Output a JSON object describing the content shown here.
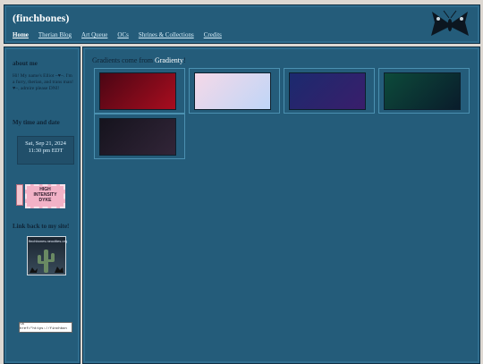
{
  "header": {
    "title": "(finchbones)",
    "nav": [
      "Home",
      "Therian Blog",
      "Art Queue",
      "OCs",
      "Shrines & Collections",
      "Credits"
    ],
    "logo_icon": "moth-icon"
  },
  "sidebar": {
    "about_heading": "about me",
    "about_text": "Hi! My name's Elliot ~♥~. I'm a furry, therian, and trans man! ♥~, admire please DNI!",
    "time_heading": "My time and date",
    "time_line1": "Sat, Sep 21, 2024",
    "time_line2": "11:30 pm EDT",
    "stamp_text": [
      "HIGH",
      "INTENSITY",
      "DYKE"
    ],
    "link_heading": "Link back to my site!",
    "badge_url": "finchbones.neocities.org",
    "code_snippet": "<a href=\"https://finchbon"
  },
  "main": {
    "intro_prefix": "Gradients come from ",
    "intro_link": "Gradienty",
    "intro_suffix": "!",
    "gradients": [
      {
        "from": "#4a0614",
        "to": "#a90d1f"
      },
      {
        "from": "#f5d8e8",
        "to": "#bfd6f7"
      },
      {
        "from": "#1b2a6e",
        "to": "#3a1e6b"
      },
      {
        "from": "#0d4a3a",
        "to": "#091c2b"
      },
      {
        "from": "#15131d",
        "to": "#322538"
      }
    ]
  },
  "colors": {
    "panel": "#245c7a",
    "page_bg": "#ddd8d2",
    "accent_link": "#ffffff"
  }
}
